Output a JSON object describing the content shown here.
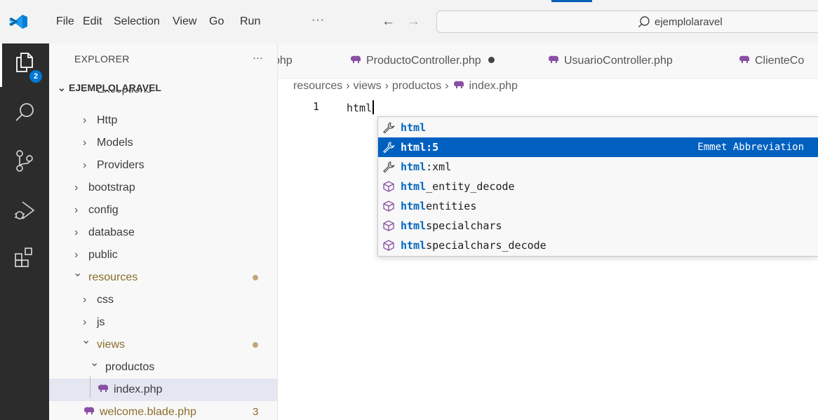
{
  "menu": [
    "File",
    "Edit",
    "Selection",
    "View",
    "Go",
    "Run"
  ],
  "menu_more": "···",
  "command_center": {
    "text": "ejemplolaravel"
  },
  "activity": {
    "explorer_badge": "2"
  },
  "sidebar": {
    "title": "EXPLORER",
    "more": "···",
    "project": "EJEMPLOLARAVEL",
    "tree": [
      {
        "label": "Exceptions",
        "chevron": "›"
      },
      {
        "label": "Http",
        "chevron": "›"
      },
      {
        "label": "Models",
        "chevron": "›"
      },
      {
        "label": "Providers",
        "chevron": "›"
      },
      {
        "label": "bootstrap",
        "chevron": "›"
      },
      {
        "label": "config",
        "chevron": "›"
      },
      {
        "label": "database",
        "chevron": "›"
      },
      {
        "label": "public",
        "chevron": "›"
      },
      {
        "label": "resources",
        "chevron": "⌄",
        "modified": true
      },
      {
        "label": "css",
        "chevron": "›"
      },
      {
        "label": "js",
        "chevron": "›"
      },
      {
        "label": "views",
        "chevron": "⌄",
        "modified": true
      },
      {
        "label": "productos",
        "chevron": "⌄"
      },
      {
        "label": "index.php"
      },
      {
        "label": "welcome.blade.php",
        "badge": "3"
      }
    ]
  },
  "tabs": [
    {
      "label": "php"
    },
    {
      "label": "ProductoController.php",
      "dirty": true
    },
    {
      "label": "UsuarioController.php"
    },
    {
      "label": "ClienteCo"
    }
  ],
  "breadcrumb": [
    "resources",
    "views",
    "productos",
    "index.php"
  ],
  "editor": {
    "line_number": "1",
    "code": "html"
  },
  "suggestions": [
    {
      "match": "html",
      "rest": "",
      "kind": "wrench"
    },
    {
      "match": "html",
      "rest": ":5",
      "kind": "wrench",
      "detail": "Emmet Abbreviation",
      "selected": true
    },
    {
      "match": "html",
      "rest": ":xml",
      "kind": "wrench"
    },
    {
      "match": "html",
      "rest": "_entity_decode",
      "kind": "cube"
    },
    {
      "match": "html",
      "rest": "entities",
      "kind": "cube"
    },
    {
      "match": "html",
      "rest": "specialchars",
      "kind": "cube"
    },
    {
      "match": "html",
      "rest": "specialchars_decode",
      "kind": "cube"
    }
  ],
  "colors": {
    "accent": "#0060c0",
    "activity_bar": "#2c2c2c",
    "badge": "#0078d4",
    "php_icon": "#8a4fa3"
  }
}
